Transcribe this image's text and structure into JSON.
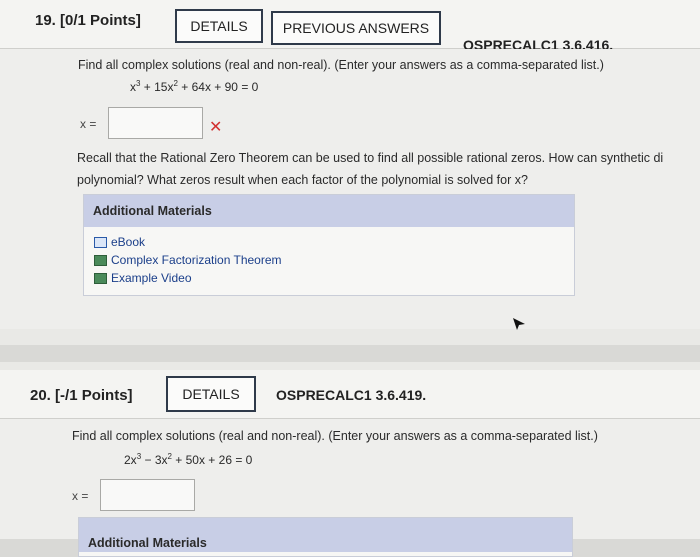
{
  "q19": {
    "number": "19.",
    "points": "[0/1 Points]",
    "details_label": "DETAILS",
    "previous_label": "PREVIOUS ANSWERS",
    "code": "OSPRECALC1 3.6.416.",
    "instruction": "Find all complex solutions (real and non-real). (Enter your answers as a comma-separated list.)",
    "eq_a": "x",
    "eq_b": " + 15x",
    "eq_c": " + 64x + 90 = 0",
    "exp": "3",
    "exp2": "2",
    "x_label": "x =",
    "answer_value": "",
    "wrong_mark": "✕",
    "hint_line1": "Recall that the Rational Zero Theorem can be used to find all possible rational zeros. How can synthetic di",
    "hint_line2": "polynomial? What zeros result when each factor of the polynomial is solved for x?",
    "materials_title": "Additional Materials",
    "materials": [
      {
        "label": "eBook",
        "icon": "ebook-icon"
      },
      {
        "label": "Complex Factorization Theorem",
        "icon": "document-icon"
      },
      {
        "label": "Example Video",
        "icon": "video-icon"
      }
    ]
  },
  "q20": {
    "number": "20.",
    "points": "[-/1 Points]",
    "details_label": "DETAILS",
    "code": "OSPRECALC1 3.6.419.",
    "instruction": "Find all complex solutions (real and non-real). (Enter your answers as a comma-separated list.)",
    "eq_a": "2x",
    "eq_b": " − 3x",
    "eq_c": " + 50x + 26 = 0",
    "exp": "3",
    "exp2": "2",
    "x_label": "x =",
    "answer_value": "",
    "materials_title": "Additional Materials"
  }
}
